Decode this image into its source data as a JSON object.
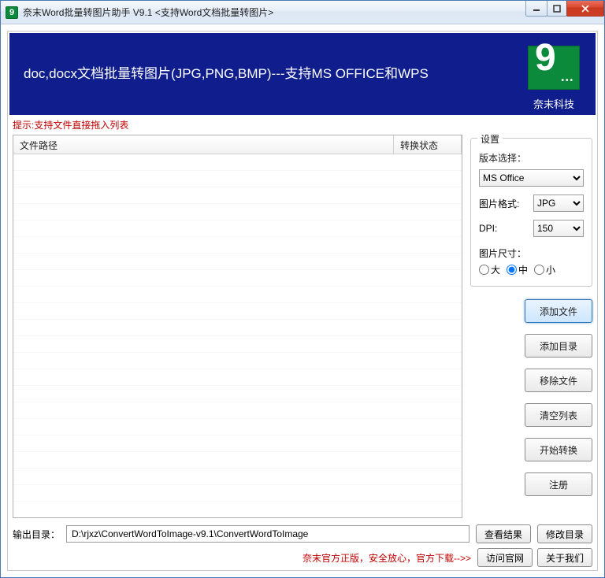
{
  "window": {
    "title": "奈末Word批量转图片助手 V9.1 <支持Word文档批量转图片>"
  },
  "banner": {
    "headline": "doc,docx文档批量转图片(JPG,PNG,BMP)---支持MS OFFICE和WPS",
    "logo_caption": "奈末科技"
  },
  "hint": "提示:支持文件直接拖入列表",
  "table": {
    "col_path": "文件路径",
    "col_status": "转换状态"
  },
  "settings": {
    "legend": "设置",
    "version_label": "版本选择：",
    "version_value": "MS Office",
    "format_label": "图片格式:",
    "format_value": "JPG",
    "dpi_label": "DPI:",
    "dpi_value": "150",
    "size_label": "图片尺寸：",
    "size_options": {
      "large": "大",
      "medium": "中",
      "small": "小"
    },
    "size_selected": "medium"
  },
  "buttons": {
    "add_file": "添加文件",
    "add_dir": "添加目录",
    "remove": "移除文件",
    "clear": "清空列表",
    "start": "开始转换",
    "register": "注册",
    "view_result": "查看结果",
    "change_dir": "修改目录",
    "visit_site": "访问官网",
    "about": "关于我们"
  },
  "output": {
    "label": "输出目录：",
    "path": "D:\\rjxz\\ConvertWordToImage-v9.1\\ConvertWordToImage"
  },
  "footer_text": "奈末官方正版，安全放心，官方下载-->>"
}
